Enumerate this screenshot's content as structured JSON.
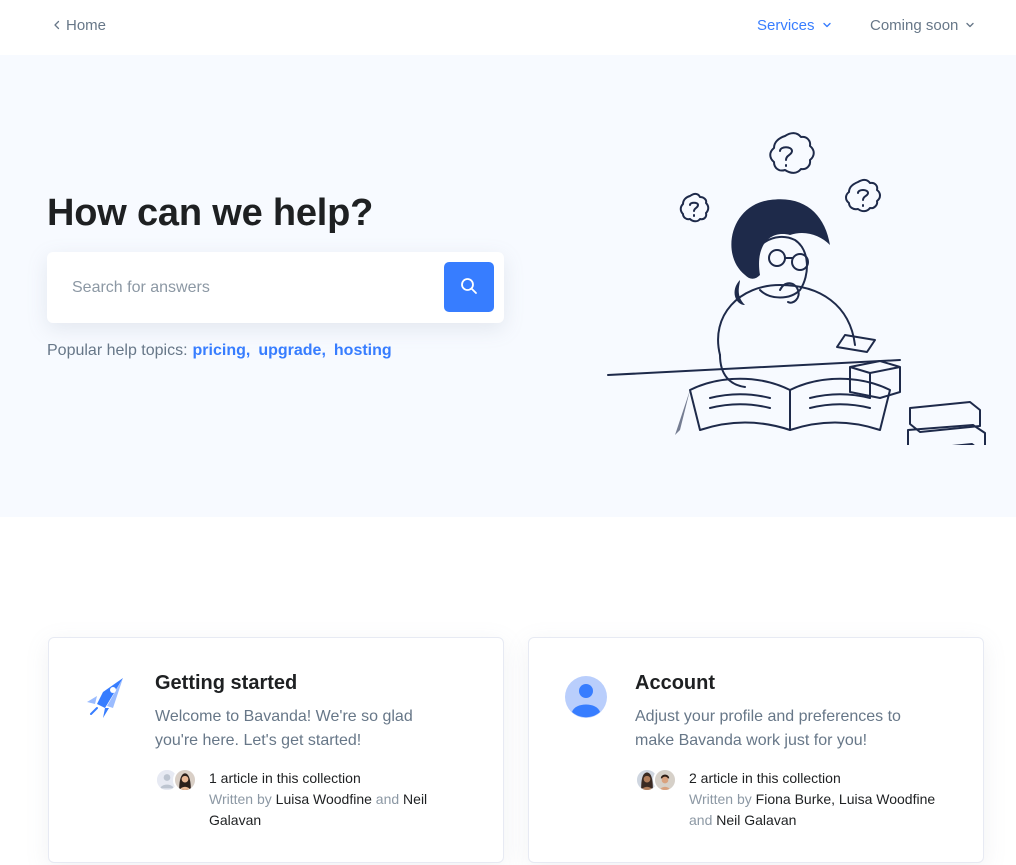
{
  "nav": {
    "home_label": "Home",
    "services_label": "Services",
    "coming_soon_label": "Coming soon"
  },
  "hero": {
    "title": "How can we help?",
    "search_placeholder": "Search for answers",
    "topics_prefix": "Popular help topics:",
    "topics": [
      "pricing",
      "upgrade",
      "hosting"
    ]
  },
  "collections": [
    {
      "title": "Getting started",
      "description": "Welcome to Bavanda! We're so glad you're here. Let's get started!",
      "count_text": "1 article in this collection",
      "written_by": "Written by",
      "authors": [
        "Luisa Woodfine",
        "Neil Galavan"
      ],
      "and": "and"
    },
    {
      "title": "Account",
      "description": "Adjust your profile and preferences to make Bavanda work just for you!",
      "count_text": "2 article in this collection",
      "written_by": "Written by",
      "authors": [
        "Fiona Burke, Luisa Woodfine",
        "Neil Galavan"
      ],
      "and": "and"
    }
  ],
  "colors": {
    "accent": "#377dff",
    "hero_bg": "#f7faff",
    "text_dark": "#1e2022",
    "text_muted": "#677788"
  }
}
